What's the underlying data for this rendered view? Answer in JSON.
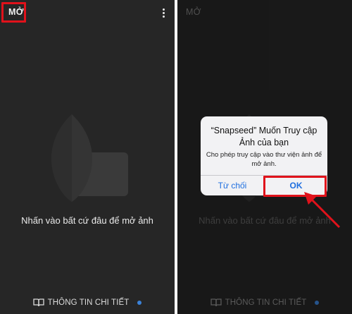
{
  "left_panel": {
    "open_label": "MỞ",
    "hint": "Nhấn vào bất cứ đâu để mở ảnh",
    "bottom_label": "THÔNG TIN CHI TIẾT"
  },
  "right_panel": {
    "open_label": "MỞ",
    "hint": "Nhấn vào bất cứ đâu để mở ảnh",
    "bottom_label": "THÔNG TIN CHI TIẾT"
  },
  "dialog": {
    "title_line1": "“Snapseed” Muốn Truy cập",
    "title_line2": "Ảnh của bạn",
    "message_line1": "Cho phép truy cập vào thư viện ảnh để",
    "message_line2": "mở ảnh.",
    "cancel_label": "Từ chối",
    "ok_label": "OK"
  },
  "colors": {
    "panel_bg": "#262626",
    "highlight": "#e0121b",
    "accent_blue": "#1f6fe0",
    "dot_blue": "#3b82d8"
  },
  "icons": [
    "more-vertical-icon",
    "snapseed-logo",
    "book-icon",
    "notification-dot",
    "arrow-icon"
  ]
}
